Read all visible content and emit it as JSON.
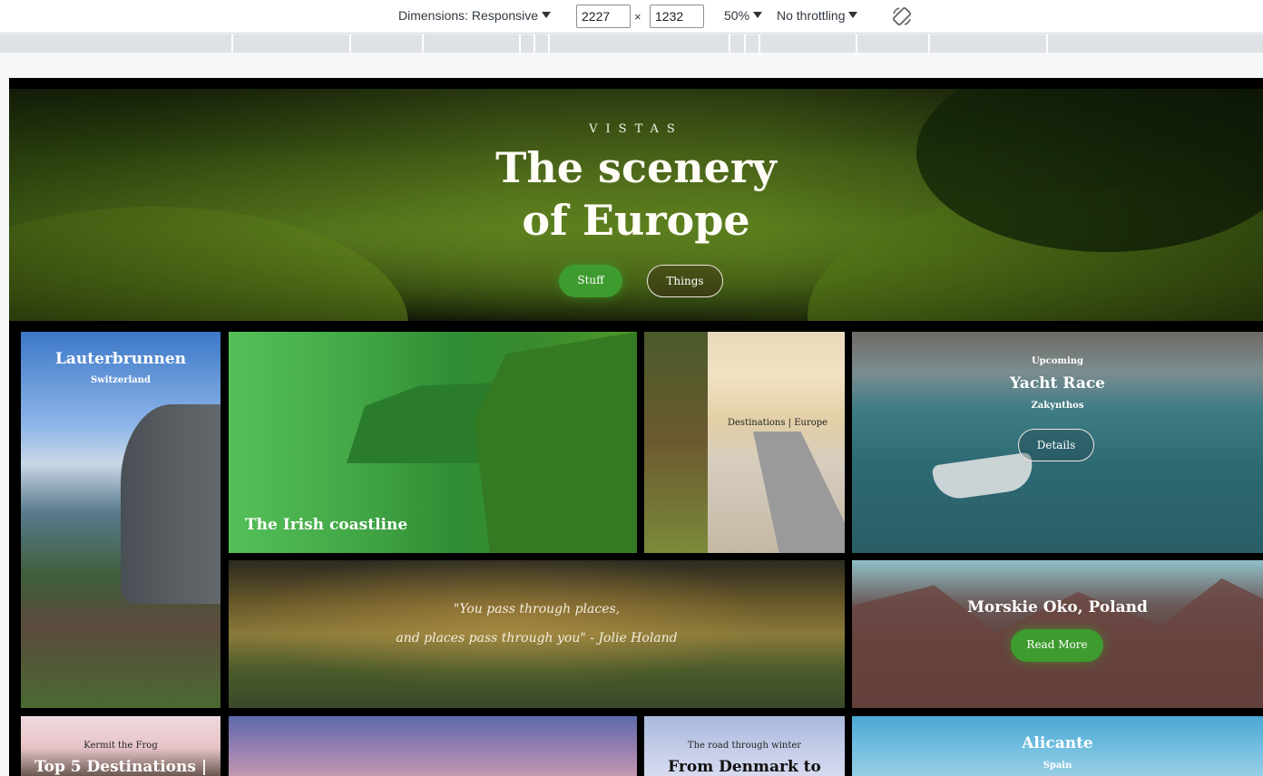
{
  "devtools": {
    "dimensions_label": "Dimensions: Responsive",
    "width_value": "2227",
    "times": "×",
    "height_value": "1232",
    "zoom": "50%",
    "throttling": "No throttling"
  },
  "hero": {
    "eyebrow": "VISTAS",
    "title_line1": "The scenery",
    "title_line2": "of Europe",
    "button_stuff": "Stuff",
    "button_things": "Things"
  },
  "tiles": {
    "lauterbrunnen": {
      "title": "Lauterbrunnen",
      "sub": "Switzerland"
    },
    "irish": {
      "title": "The Irish coastline"
    },
    "road": {
      "caption": "Destinations | Europe"
    },
    "yacht": {
      "eyebrow": "Upcoming",
      "title": "Yacht Race",
      "sub": "Zakynthos",
      "button": "Details"
    },
    "quote": {
      "line1": "\"You pass through places,",
      "line2": "and places pass through you\" - Jolie Holand"
    },
    "morskie": {
      "title": "Morskie Oko, Poland",
      "button": "Read More"
    },
    "kermit": {
      "eyebrow": "Kermit the Frog",
      "title": "Top 5 Destinations |"
    },
    "denmark": {
      "eyebrow": "The road through winter",
      "title": "From Denmark to"
    },
    "alicante": {
      "title": "Alicante",
      "sub": "Spain"
    }
  }
}
